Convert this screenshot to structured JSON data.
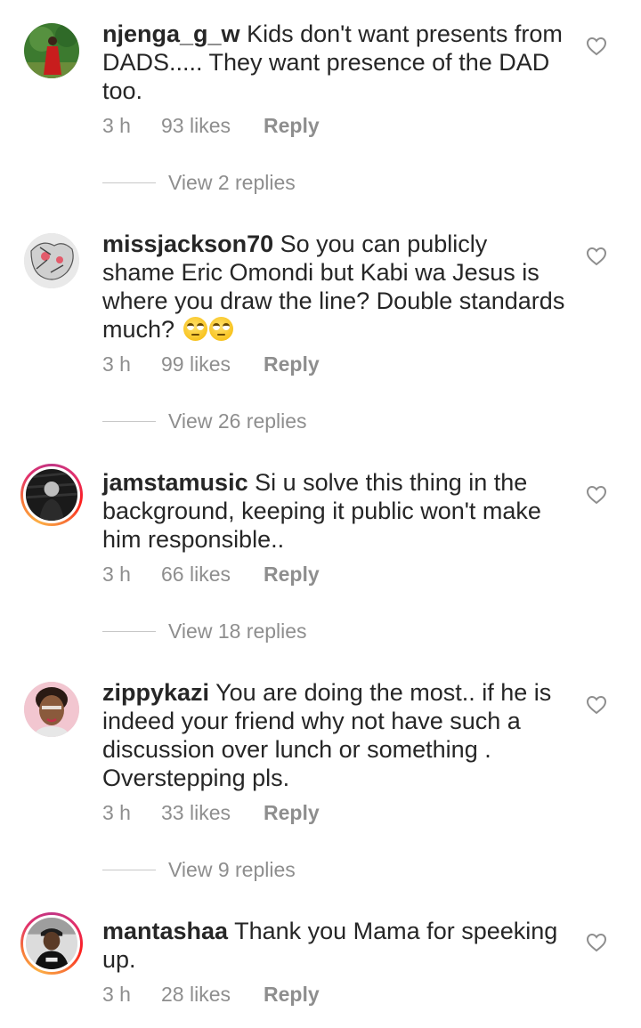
{
  "comments": [
    {
      "username": "njenga_g_w",
      "text": "Kids don't want presents from DADS..... They want presence of the DAD too.",
      "time": "3 h",
      "likes": "93 likes",
      "reply_label": "Reply",
      "view_replies": "View 2 replies",
      "avatar": "person-red-dress-avatar",
      "story_ring": false
    },
    {
      "username": "missjackson70",
      "text": "So you can publicly shame Eric Omondi but Kabi wa Jesus is where you draw the line? Double standards much?",
      "emoji": [
        "eye-roll-emoji",
        "eye-roll-emoji"
      ],
      "time": "3 h",
      "likes": "99 likes",
      "reply_label": "Reply",
      "view_replies": "View 26 replies",
      "avatar": "illustration-avatar",
      "story_ring": false
    },
    {
      "username": "jamstamusic",
      "text": "Si u solve this thing in the background, keeping it public won't make him responsible..",
      "time": "3 h",
      "likes": "66 likes",
      "reply_label": "Reply",
      "view_replies": "View 18 replies",
      "avatar": "dark-photo-avatar",
      "story_ring": true
    },
    {
      "username": "zippykazi",
      "text": "You are doing the most.. if he is indeed your friend why not have such a discussion over lunch or something . Overstepping pls.",
      "time": "3 h",
      "likes": "33 likes",
      "reply_label": "Reply",
      "view_replies": "View 9 replies",
      "avatar": "woman-portrait-avatar",
      "story_ring": false
    },
    {
      "username": "mantashaa",
      "text": "Thank you Mama for speeking up.",
      "time": "3 h",
      "likes": "28 likes",
      "reply_label": "Reply",
      "avatar": "man-cap-avatar",
      "story_ring": true
    }
  ],
  "colors": {
    "text": "#262626",
    "secondary": "#8e8e8e",
    "divider": "#c7c7c7",
    "story_ring": "#e1306c"
  },
  "icons": {
    "like": "heart-outline-icon"
  }
}
